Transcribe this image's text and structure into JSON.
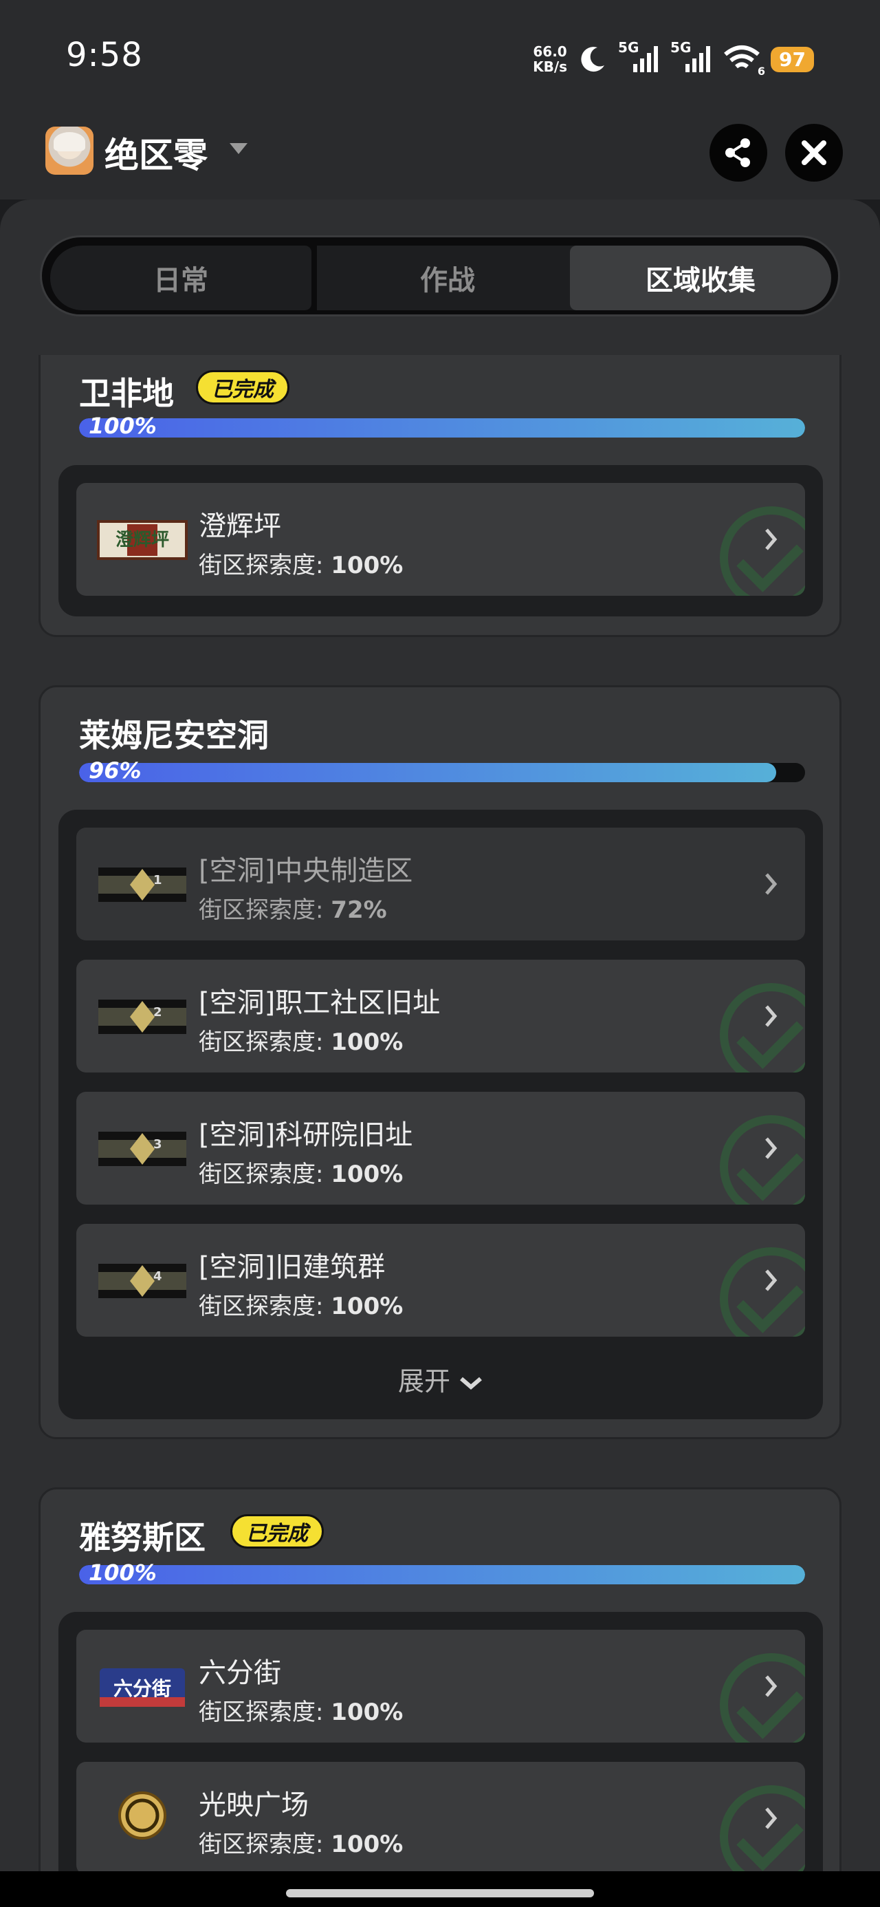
{
  "status_bar": {
    "time": "9:58",
    "net_speed_value": "66.0",
    "net_speed_unit": "KB/s",
    "signal_1_label": "5G",
    "signal_2_label": "5G",
    "wifi_badge": "6",
    "battery": "97"
  },
  "app": {
    "title": "绝区零",
    "tabs": [
      {
        "label": "日常"
      },
      {
        "label": "作战"
      },
      {
        "label": "区域收集"
      }
    ]
  },
  "regions": [
    {
      "title": "卫非地",
      "badge": "已完成",
      "progress_label": "100%",
      "progress": 1.0,
      "items": [
        {
          "name": "澄辉坪",
          "sub_label": "街区探索度:",
          "value": "100%",
          "thumb_text": "澄辉坪"
        }
      ]
    },
    {
      "title": "莱姆尼安空洞",
      "progress_label": "96%",
      "progress": 0.96,
      "items": [
        {
          "name": "[空洞]中央制造区",
          "sub_label": "街区探索度:",
          "value": "72%",
          "thumb_text": "1"
        },
        {
          "name": "[空洞]职工社区旧址",
          "sub_label": "街区探索度:",
          "value": "100%",
          "thumb_text": "2"
        },
        {
          "name": "[空洞]科研院旧址",
          "sub_label": "街区探索度:",
          "value": "100%",
          "thumb_text": "3"
        },
        {
          "name": "[空洞]旧建筑群",
          "sub_label": "街区探索度:",
          "value": "100%",
          "thumb_text": "4"
        }
      ],
      "expand_label": "展开"
    },
    {
      "title": "雅努斯区",
      "badge": "已完成",
      "progress_label": "100%",
      "progress": 1.0,
      "items": [
        {
          "name": "六分街",
          "sub_label": "街区探索度:",
          "value": "100%",
          "thumb_text": "六分街"
        },
        {
          "name": "光映广场",
          "sub_label": "街区探索度:",
          "value": "100%",
          "thumb_text": ""
        }
      ]
    }
  ]
}
